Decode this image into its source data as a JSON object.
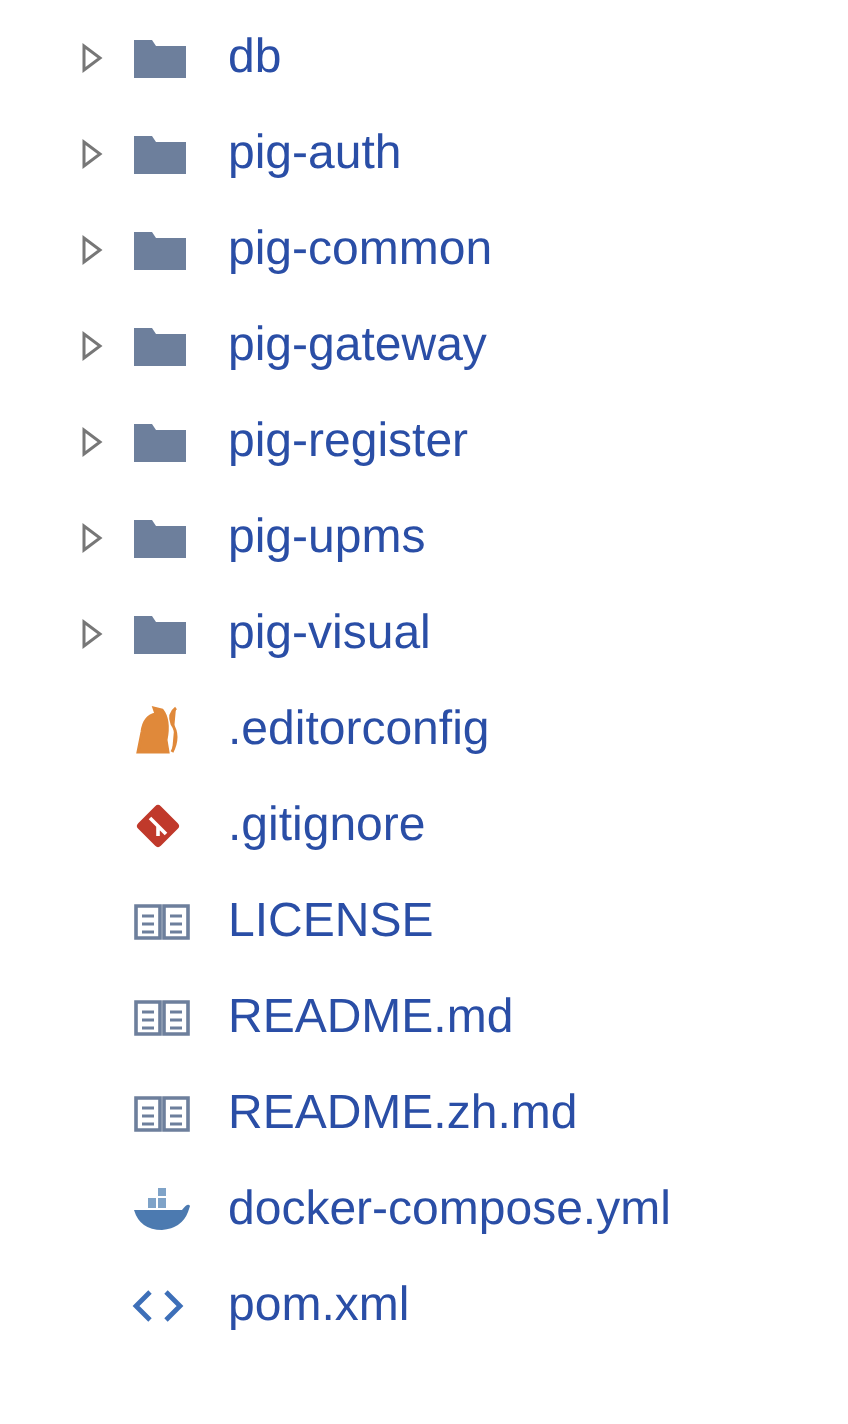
{
  "tree": [
    {
      "kind": "folder",
      "name": "db",
      "expanded": false
    },
    {
      "kind": "folder",
      "name": "pig-auth",
      "expanded": false
    },
    {
      "kind": "folder",
      "name": "pig-common",
      "expanded": false
    },
    {
      "kind": "folder",
      "name": "pig-gateway",
      "expanded": false
    },
    {
      "kind": "folder",
      "name": "pig-register",
      "expanded": false
    },
    {
      "kind": "folder",
      "name": "pig-upms",
      "expanded": false
    },
    {
      "kind": "folder",
      "name": "pig-visual",
      "expanded": false
    },
    {
      "kind": "config",
      "name": ".editorconfig"
    },
    {
      "kind": "git",
      "name": ".gitignore"
    },
    {
      "kind": "book",
      "name": "LICENSE"
    },
    {
      "kind": "book",
      "name": "README.md"
    },
    {
      "kind": "book",
      "name": "README.zh.md"
    },
    {
      "kind": "docker",
      "name": "docker-compose.yml"
    },
    {
      "kind": "code",
      "name": "pom.xml"
    }
  ]
}
